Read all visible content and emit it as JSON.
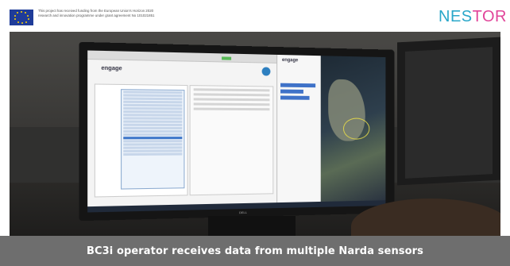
{
  "header": {
    "funding_text": "This project has received funding from the European Union's Horizon 2020 research and innovation programme under grant agreement No 101021851",
    "logo": {
      "part1": "NES",
      "part2": "TOR"
    }
  },
  "photo": {
    "screen_left_brand": "engage",
    "screen_right_brand": "engage",
    "monitor_brand": "DELL"
  },
  "caption": "BC3i operator receives data from multiple Narda sensors",
  "colors": {
    "caption_bg": "#6e6e6e",
    "eu_blue": "#1f3c99",
    "logo_cyan": "#2aa7c9",
    "logo_pink": "#e1459a"
  }
}
